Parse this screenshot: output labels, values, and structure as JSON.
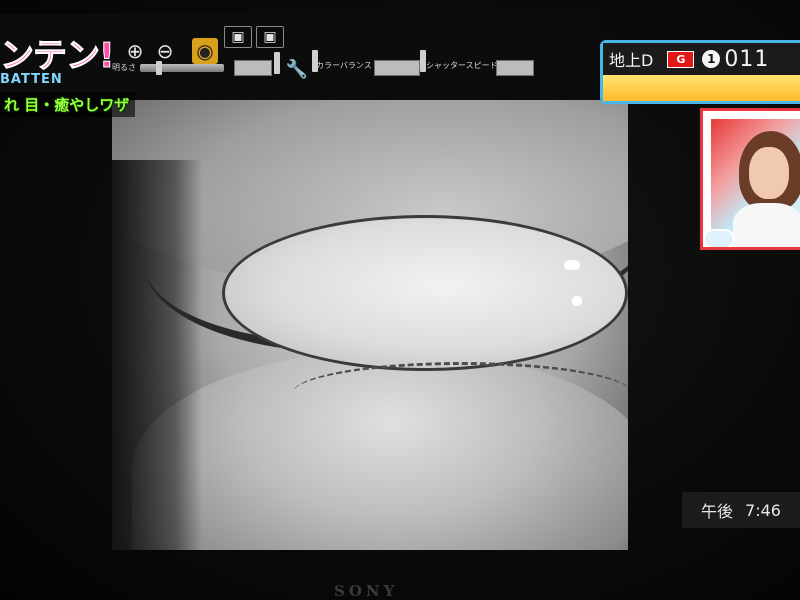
{
  "toolbar": {
    "zoom_in_icon": "zoom-in-icon",
    "zoom_out_icon": "zoom-out-icon",
    "label_brightness": "明るさ",
    "label_color_balance": "カラーバランス",
    "label_shutter_speed": "シャッタースピード"
  },
  "show": {
    "logo_text": "ンテン!",
    "logo_sub": "BATTEN",
    "telop": "れ 目・癒やしワザ"
  },
  "channel": {
    "label": "地上D",
    "badge": "G",
    "number_icon": "1",
    "number": "011"
  },
  "clock": {
    "period": "午後",
    "time": "7:46"
  },
  "bezel": {
    "brand": "SONY"
  },
  "colors": {
    "channel_border": "#47b6e8",
    "telop_green": "#9aff3b",
    "logo_pink": "#ff4fa8",
    "active_tool": "#d9a11b",
    "wipe_border": "#e8383d"
  }
}
